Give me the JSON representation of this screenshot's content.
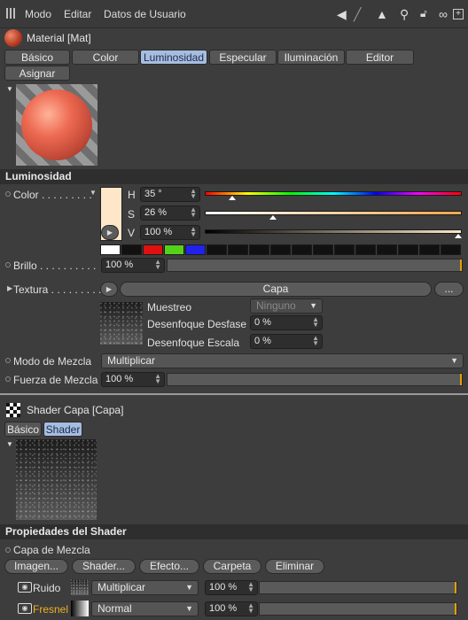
{
  "menu": {
    "items": [
      "Modo",
      "Editar",
      "Datos de Usuario"
    ]
  },
  "header": {
    "title": "Material [Mat]"
  },
  "tabs": [
    {
      "label": "Básico",
      "active": false
    },
    {
      "label": "Color",
      "active": false
    },
    {
      "label": "Luminosidad",
      "active": true
    },
    {
      "label": "Especular",
      "active": false
    },
    {
      "label": "Iluminación",
      "active": false
    },
    {
      "label": "Editor",
      "active": false
    },
    {
      "label": "Asignar",
      "active": false
    }
  ],
  "luminosidad": {
    "section_title": "Luminosidad",
    "color_label": "Color . . . . . . . . .",
    "swatch_color": "#fde7c8",
    "h_label": "H",
    "h_value": "35 °",
    "h_fraction": 0.097,
    "s_label": "S",
    "s_value": "26 %",
    "s_fraction": 0.26,
    "v_label": "V",
    "v_value": "100 %",
    "v_fraction": 1.0,
    "preset_colors": [
      "#ffffff",
      "#111111",
      "#e01010",
      "#55d11a",
      "#2222ee",
      "#111111",
      "#111111",
      "#111111",
      "#111111",
      "#111111",
      "#111111",
      "#111111",
      "#111111",
      "#111111",
      "#111111",
      "#111111",
      "#111111"
    ],
    "brillo_label": "Brillo . . . . . . . . . .",
    "brillo_value": "100 %",
    "textura_label": "Textura . . . . . . . . .",
    "textura_button": "Capa",
    "textura_more": "...",
    "muestreo_label": "Muestreo",
    "muestreo_value": "Ninguno",
    "desenfoque_desfase_label": "Desenfoque Desfase",
    "desenfoque_desfase_value": "0 %",
    "desenfoque_escala_label": "Desenfoque Escala",
    "desenfoque_escala_value": "0 %",
    "modo_mezcla_label": "Modo de Mezcla",
    "modo_mezcla_value": "Multiplicar",
    "fuerza_mezcla_label": "Fuerza de Mezcla",
    "fuerza_mezcla_value": "100 %"
  },
  "shader": {
    "title": "Shader Capa [Capa]",
    "tabs": [
      {
        "label": "Básico",
        "active": false
      },
      {
        "label": "Shader",
        "active": true
      }
    ],
    "section_title": "Propiedades del Shader",
    "capa_label": "Capa de Mezcla",
    "buttons": [
      "Imagen...",
      "Shader...",
      "Efecto...",
      "Carpeta",
      "Eliminar"
    ],
    "layers": [
      {
        "name": "Ruido",
        "mode": "Multiplicar",
        "value": "100 %",
        "name_color": "#e6e6e6",
        "thumb": "noise"
      },
      {
        "name": "Fresnel",
        "mode": "Normal",
        "value": "100 %",
        "name_color": "#f0b020",
        "thumb": "gradient"
      }
    ]
  }
}
